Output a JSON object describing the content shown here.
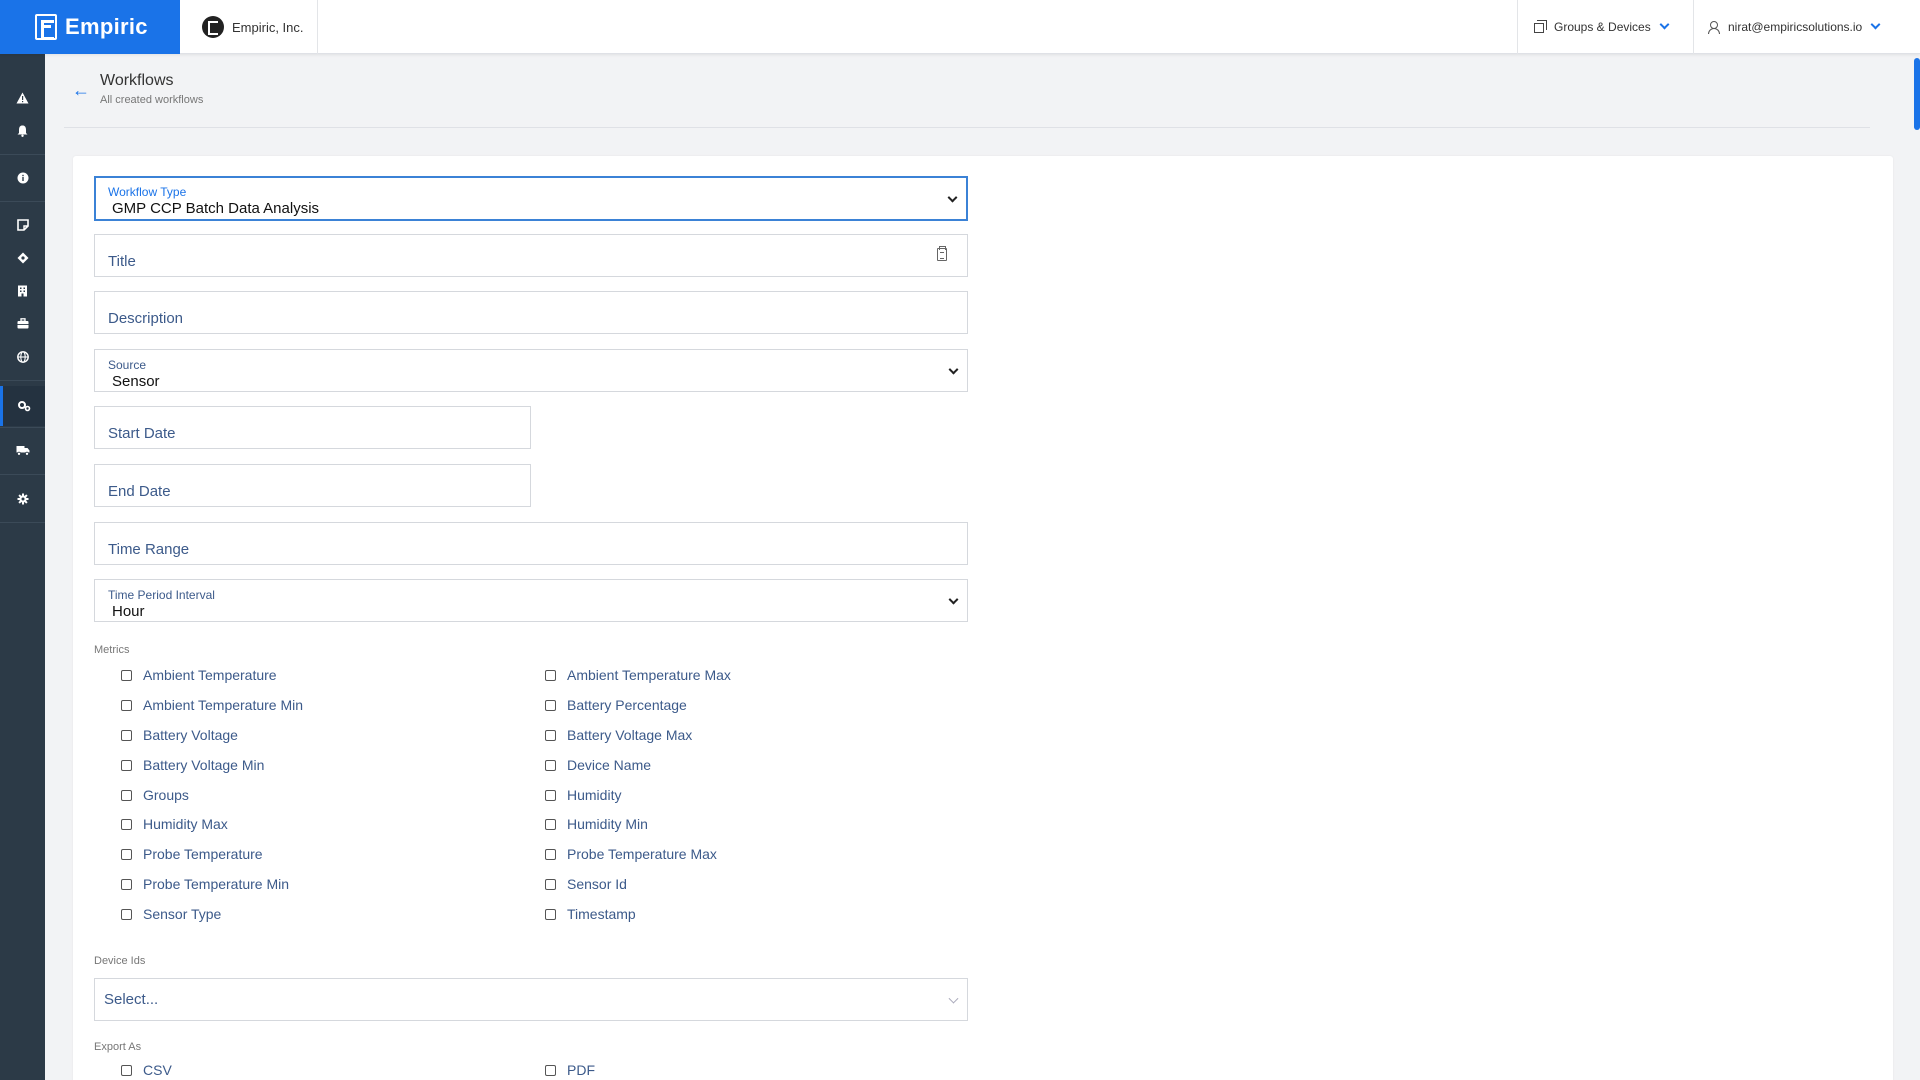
{
  "header": {
    "brand": "Empiric",
    "organization": "Empiric, Inc.",
    "groups_devices": "Groups & Devices",
    "user_email": "nirat@empiricsolutions.io"
  },
  "sidebar": {
    "items": [
      {
        "icon": "alert-triangle-icon"
      },
      {
        "icon": "bell-icon"
      },
      {
        "icon": "info-icon"
      },
      {
        "icon": "note-icon"
      },
      {
        "icon": "diamond-icon"
      },
      {
        "icon": "building-icon"
      },
      {
        "icon": "briefcase-icon"
      },
      {
        "icon": "globe-icon"
      },
      {
        "icon": "gears-icon",
        "active": true
      },
      {
        "icon": "truck-icon"
      },
      {
        "icon": "settings-icon"
      }
    ]
  },
  "page": {
    "title": "Workflows",
    "subtitle": "All created workflows"
  },
  "form": {
    "workflow_type": {
      "label": "Workflow Type",
      "value": "GMP CCP Batch Data Analysis"
    },
    "title": {
      "placeholder": "Title"
    },
    "description": {
      "placeholder": "Description"
    },
    "source": {
      "label": "Source",
      "value": "Sensor"
    },
    "start_date": {
      "placeholder": "Start Date"
    },
    "end_date": {
      "placeholder": "End Date"
    },
    "time_range": {
      "placeholder": "Time Range"
    },
    "time_period_interval": {
      "label": "Time Period Interval",
      "value": "Hour"
    },
    "metrics": {
      "label": "Metrics",
      "left": [
        "Ambient Temperature",
        "Ambient Temperature Min",
        "Battery Voltage",
        "Battery Voltage Min",
        "Groups",
        "Humidity Max",
        "Probe Temperature",
        "Probe Temperature Min",
        "Sensor Type"
      ],
      "right": [
        "Ambient Temperature Max",
        "Battery Percentage",
        "Battery Voltage Max",
        "Device Name",
        "Humidity",
        "Humidity Min",
        "Probe Temperature Max",
        "Sensor Id",
        "Timestamp"
      ]
    },
    "device_ids": {
      "label": "Device Ids",
      "placeholder": "Select..."
    },
    "export_as": {
      "label": "Export As",
      "options": [
        "CSV",
        "PDF"
      ]
    }
  }
}
